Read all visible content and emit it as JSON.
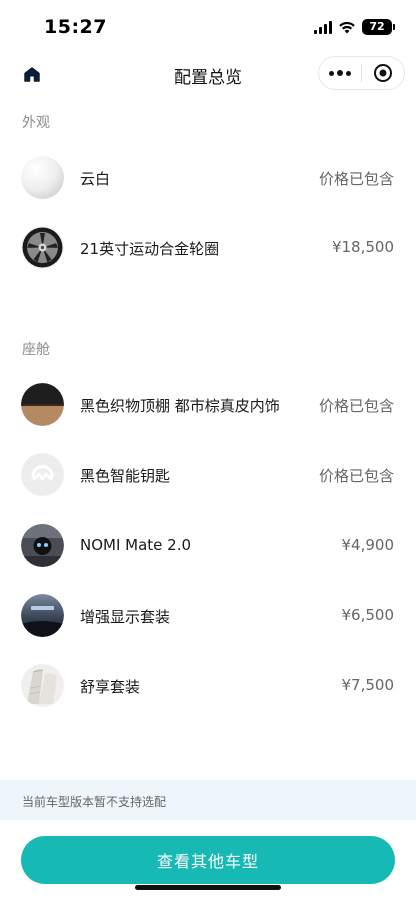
{
  "status_bar": {
    "time": "15:27",
    "battery": "72"
  },
  "nav": {
    "title": "配置总览"
  },
  "sections": {
    "exterior": {
      "label": "外观",
      "items": [
        {
          "name": "云白",
          "price": "价格已包含",
          "thumb": "white-sphere"
        },
        {
          "name": "21英寸运动合金轮圈",
          "price": "¥18,500",
          "thumb": "alloy-wheel"
        }
      ]
    },
    "cabin": {
      "label": "座舱",
      "items": [
        {
          "name": "黑色织物顶棚 都市棕真皮内饰",
          "price": "价格已包含",
          "thumb": "black-brown-interior"
        },
        {
          "name": "黑色智能钥匙",
          "price": "价格已包含",
          "thumb": "nio-key-logo"
        },
        {
          "name": "NOMI Mate 2.0",
          "price": "¥4,900",
          "thumb": "nomi-assistant"
        },
        {
          "name": "增强显示套装",
          "price": "¥6,500",
          "thumb": "display-dashboard"
        },
        {
          "name": "舒享套装",
          "price": "¥7,500",
          "thumb": "comfort-seat"
        }
      ]
    }
  },
  "notice": {
    "text": "当前车型版本暂不支持选配"
  },
  "cta": {
    "label": "查看其他车型"
  },
  "colors": {
    "accent": "#17b9b4",
    "notice_bg": "#eef6fb",
    "section_label": "#8c8c8c"
  }
}
